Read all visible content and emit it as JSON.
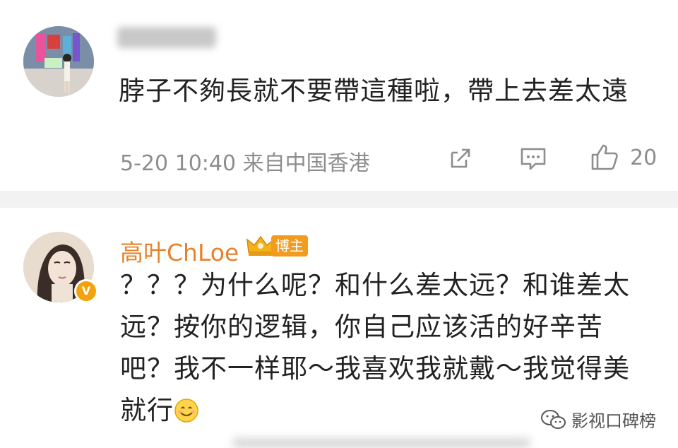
{
  "comment1": {
    "text": "脖子不夠長就不要帶這種啦，帶上去差太遠",
    "meta": "5-20 10:40 来自中国香港",
    "like_count": "20",
    "icons": [
      "share-icon",
      "comment-icon",
      "like-icon"
    ]
  },
  "comment2": {
    "username": "高叶ChLoe",
    "badge": "博主",
    "verified": "V",
    "text": "？？？为什么呢？和什么差太远？和谁差太远？按你的逻辑，你自己应该活的好辛苦吧？我不一样耶～我喜欢我就戴～我觉得美就行"
  },
  "watermark": {
    "text": "影视口碑榜",
    "icon": "wechat-icon"
  },
  "colors": {
    "username": "#e8822a",
    "badge": "#f29c1f",
    "meta": "#8d8d8d",
    "separator": "#f2f2f2"
  }
}
